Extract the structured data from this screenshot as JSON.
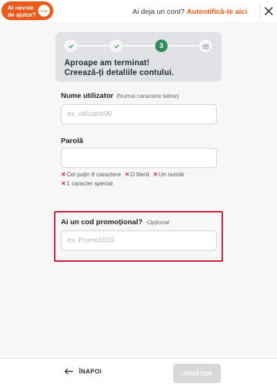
{
  "header": {
    "help_line1": "Ai nevoie",
    "help_line2": "de ajutor?",
    "help_icon": "chat-bubble-icon",
    "account_question": "Ai deja un cont?",
    "login_link": "Autentifică-te aici",
    "close_icon": "close-icon"
  },
  "progress": {
    "steps": [
      {
        "state": "done",
        "icon": "check-icon"
      },
      {
        "state": "done",
        "icon": "check-icon"
      },
      {
        "state": "current",
        "label": "3"
      },
      {
        "state": "upcoming",
        "icon": "gift-icon"
      }
    ],
    "title_line1": "Aproape am terminat!",
    "title_line2": "Creează-ți detaliile contului."
  },
  "username": {
    "label": "Nume utilizator",
    "hint": "(Numai caractere latine)",
    "placeholder": "ex. utilizator90",
    "value": ""
  },
  "password": {
    "label": "Parolă",
    "placeholder": "",
    "value": "",
    "rules": [
      "Cel puțin 8 caractere",
      "O literă",
      "Un număr",
      "1 caracter special"
    ]
  },
  "promo": {
    "label": "Ai un cod promoțional?",
    "hint": "-Opțional",
    "placeholder": "ex. Promo1010",
    "value": ""
  },
  "footer": {
    "back_label": "ÎNAPOI",
    "next_label": "URMĂTOR"
  },
  "colors": {
    "accent": "#ea5b1b",
    "step_active": "#2f8f5b",
    "highlight_border": "#c8102e",
    "error": "#dd3333"
  }
}
